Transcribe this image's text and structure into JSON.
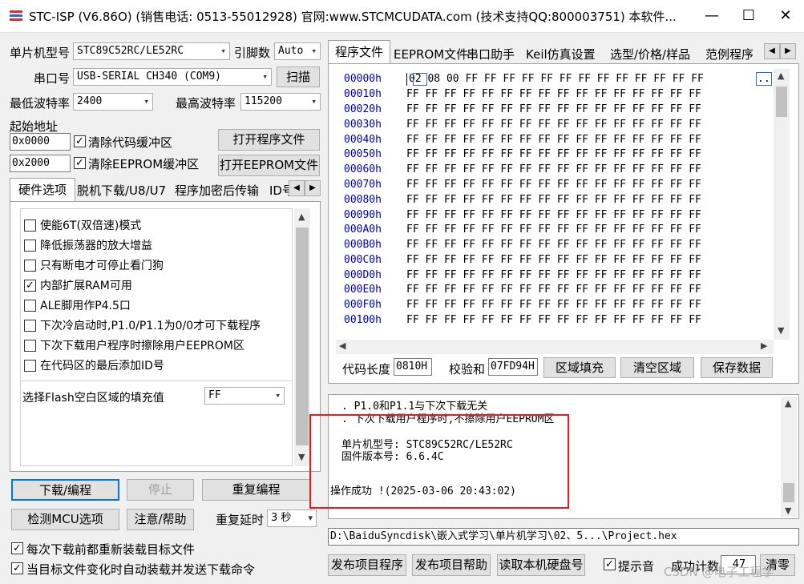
{
  "window": {
    "title": "STC-ISP (V6.86O) (销售电话: 0513-55012928) 官网:www.STCMCUDATA.com  (技术支持QQ:800003751) 本软件...",
    "minimize": "—",
    "maximize": "☐",
    "close": "✕"
  },
  "left": {
    "mcu_label": "单片机型号",
    "mcu_value": "STC89C52RC/LE52RC",
    "pins_label": "引脚数",
    "pins_value": "Auto",
    "port_label": "串口号",
    "port_value": "USB-SERIAL CH340 (COM9)",
    "scan_button": "扫描",
    "min_baud_label": "最低波特率",
    "min_baud_value": "2400",
    "max_baud_label": "最高波特率",
    "max_baud_value": "115200",
    "start_addr_label": "起始地址",
    "addr1": "0x0000",
    "clear_code_label": "清除代码缓冲区",
    "open_program_button": "打开程序文件",
    "addr2": "0x2000",
    "clear_eeprom_label": "清除EEPROM缓冲区",
    "open_eeprom_button": "打开EEPROM文件",
    "tabs": [
      "硬件选项",
      "脱机下载/U8/U7",
      "程序加密后传输",
      "ID号"
    ],
    "options": [
      {
        "label": "使能6T(双倍速)模式",
        "checked": false
      },
      {
        "label": "降低振荡器的放大增益",
        "checked": false
      },
      {
        "label": "只有断电才可停止看门狗",
        "checked": false
      },
      {
        "label": "内部扩展RAM可用",
        "checked": true
      },
      {
        "label": "ALE脚用作P4.5口",
        "checked": false
      },
      {
        "label": "下次冷启动时,P1.0/P1.1为0/0才可下载程序",
        "checked": false
      },
      {
        "label": "下次下载用户程序时擦除用户EEPROM区",
        "checked": false
      },
      {
        "label": "在代码区的最后添加ID号",
        "checked": false
      }
    ],
    "fill_label": "选择Flash空白区域的填充值",
    "fill_value": "FF",
    "download_button": "下载/编程",
    "stop_button": "停止",
    "reprogram_button": "重复编程",
    "detect_button": "检测MCU选项",
    "help_button": "注意/帮助",
    "repeat_delay_label": "重复延时",
    "repeat_delay_value": "3 秒",
    "reload_label": "每次下载前都重新装载目标文件",
    "autoload_label": "当目标文件变化时自动装载并发送下载命令"
  },
  "right": {
    "tabs": [
      "程序文件",
      "EEPROM文件",
      "串口助手",
      "Keil仿真设置",
      "选型/价格/样品",
      "范例程序"
    ],
    "hex_rows": [
      {
        "addr": "00000h",
        "bytes": "02 08 00 FF FF FF FF FF FF FF FF FF FF FF FF FF"
      },
      {
        "addr": "00010h",
        "bytes": "FF FF FF FF FF FF FF FF FF FF FF FF FF FF FF FF"
      },
      {
        "addr": "00020h",
        "bytes": "FF FF FF FF FF FF FF FF FF FF FF FF FF FF FF FF"
      },
      {
        "addr": "00030h",
        "bytes": "FF FF FF FF FF FF FF FF FF FF FF FF FF FF FF FF"
      },
      {
        "addr": "00040h",
        "bytes": "FF FF FF FF FF FF FF FF FF FF FF FF FF FF FF FF"
      },
      {
        "addr": "00050h",
        "bytes": "FF FF FF FF FF FF FF FF FF FF FF FF FF FF FF FF"
      },
      {
        "addr": "00060h",
        "bytes": "FF FF FF FF FF FF FF FF FF FF FF FF FF FF FF FF"
      },
      {
        "addr": "00070h",
        "bytes": "FF FF FF FF FF FF FF FF FF FF FF FF FF FF FF FF"
      },
      {
        "addr": "00080h",
        "bytes": "FF FF FF FF FF FF FF FF FF FF FF FF FF FF FF FF"
      },
      {
        "addr": "00090h",
        "bytes": "FF FF FF FF FF FF FF FF FF FF FF FF FF FF FF FF"
      },
      {
        "addr": "000A0h",
        "bytes": "FF FF FF FF FF FF FF FF FF FF FF FF FF FF FF FF"
      },
      {
        "addr": "000B0h",
        "bytes": "FF FF FF FF FF FF FF FF FF FF FF FF FF FF FF FF"
      },
      {
        "addr": "000C0h",
        "bytes": "FF FF FF FF FF FF FF FF FF FF FF FF FF FF FF FF"
      },
      {
        "addr": "000D0h",
        "bytes": "FF FF FF FF FF FF FF FF FF FF FF FF FF FF FF FF"
      },
      {
        "addr": "000E0h",
        "bytes": "FF FF FF FF FF FF FF FF FF FF FF FF FF FF FF FF"
      },
      {
        "addr": "000F0h",
        "bytes": "FF FF FF FF FF FF FF FF FF FF FF FF FF FF FF FF"
      },
      {
        "addr": "00100h",
        "bytes": "FF FF FF FF FF FF FF FF FF FF FF FF FF FF FF FF"
      }
    ],
    "ascii_preview": "..",
    "code_len_label": "代码长度",
    "code_len_value": "0810H",
    "checksum_label": "校验和",
    "checksum_value": "07FD94H",
    "fill_area_button": "区域填充",
    "clear_area_button": "清空区域",
    "save_data_button": "保存数据",
    "log_line1": ". P1.0和P1.1与下次下载无关",
    "log_line2": ". 下次下载用户程序时,不擦除用户EEPROM区",
    "log_mcu": "单片机型号: STC89C52RC/LE52RC",
    "log_fw": "固件版本号: 6.6.4C",
    "log_success": "操作成功 !(2025-03-06 20:43:02)",
    "file_path": "D:\\BaiduSyncdisk\\嵌入式学习\\单片机学习\\02、5...\\Project.hex",
    "publish_button": "发布项目程序",
    "publish_help_button": "发布项目帮助",
    "read_disk_button": "读取本机硬盘号",
    "sound_label": "提示音",
    "success_count_label": "成功计数",
    "success_count_value": "47",
    "clear_button": "清零",
    "watermark": "CSDN @电子工程学"
  },
  "colors": {
    "highlight": "#e02020",
    "accent": "#0000cc"
  }
}
